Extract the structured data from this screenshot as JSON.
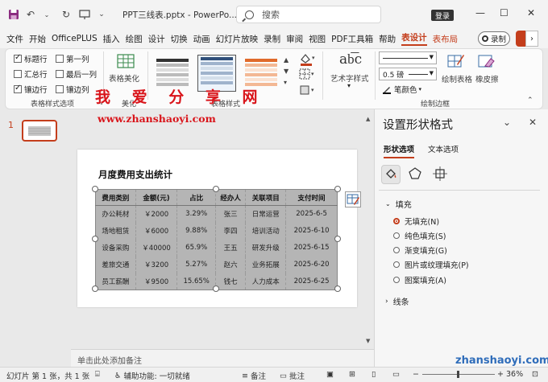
{
  "titlebar": {
    "doc_title": "PPT三线表.pptx  -  PowerPo...",
    "search_placeholder": "搜索",
    "login_label": "登录",
    "undo_glyph": "↶",
    "redo_glyph": "↻",
    "minimize_glyph": "—",
    "maximize_glyph": "☐",
    "close_glyph": "✕"
  },
  "tabs": [
    "文件",
    "开始",
    "OfficePLUS",
    "插入",
    "绘图",
    "设计",
    "切换",
    "动画",
    "幻灯片放映",
    "录制",
    "审阅",
    "视图",
    "PDF工具箱",
    "帮助"
  ],
  "active_tab": "表设计",
  "extra_tab": "表布局",
  "record_label": "录制",
  "ribbon": {
    "options": [
      {
        "label": "标题行",
        "checked": true
      },
      {
        "label": "第一列",
        "checked": false
      },
      {
        "label": "汇总行",
        "checked": false
      },
      {
        "label": "最后一列",
        "checked": false
      },
      {
        "label": "镶边行",
        "checked": true
      },
      {
        "label": "镶边列",
        "checked": false
      }
    ],
    "group1_label": "表格样式选项",
    "beautify_label": "表格美化",
    "beautify_group_label": "美化",
    "group2_label": "表格样式",
    "art_label": "艺术字样式",
    "pen_weight": "0.5 磅",
    "pen_color_label": "笔颜色",
    "draw_table_label": "绘制表格",
    "eraser_label": "橡皮擦",
    "group3_label": "绘制边框"
  },
  "watermark": {
    "line1": "我 爱 分 享 网",
    "line2": "www.zhanshaoyi.com",
    "line3": "zhanshaoyi.com"
  },
  "thumbnail": {
    "number": "1"
  },
  "slide": {
    "title": "月度费用支出统计",
    "table": {
      "headers": [
        "费用类别",
        "金额(元)",
        "占比",
        "经办人",
        "关联项目",
        "支付时间"
      ],
      "rows": [
        [
          "办公耗材",
          "￥2000",
          "3.29%",
          "张三",
          "日常运营",
          "2025-6-5"
        ],
        [
          "场地租赁",
          "￥6000",
          "9.88%",
          "李四",
          "培训活动",
          "2025-6-10"
        ],
        [
          "设备采购",
          "￥40000",
          "65.9%",
          "王五",
          "研发升级",
          "2025-6-15"
        ],
        [
          "差旅交通",
          "￥3200",
          "5.27%",
          "赵六",
          "业务拓展",
          "2025-6-20"
        ],
        [
          "员工薪酬",
          "￥9500",
          "15.65%",
          "钱七",
          "人力成本",
          "2025-6-25"
        ]
      ]
    }
  },
  "notes_placeholder": "单击此处添加备注",
  "pane": {
    "title": "设置形状格式",
    "tabs": [
      "形状选项",
      "文本选项"
    ],
    "fill_section": "填充",
    "fill_options": [
      {
        "label": "无填充(N)",
        "selected": true
      },
      {
        "label": "纯色填充(S)",
        "selected": false
      },
      {
        "label": "渐变填充(G)",
        "selected": false
      },
      {
        "label": "图片或纹理填充(P)",
        "selected": false
      },
      {
        "label": "图案填充(A)",
        "selected": false
      }
    ],
    "line_section": "线条"
  },
  "status": {
    "slide_info": "幻灯片 第 1 张，共 1 张",
    "accessibility": "辅助功能: 一切就绪",
    "notes_label": "备注",
    "comments_label": "批注",
    "zoom": "36%"
  },
  "colors": {
    "accent": "#c43e1c",
    "watermark_red": "#d9151b",
    "table_fill": "#b5b5b5"
  }
}
